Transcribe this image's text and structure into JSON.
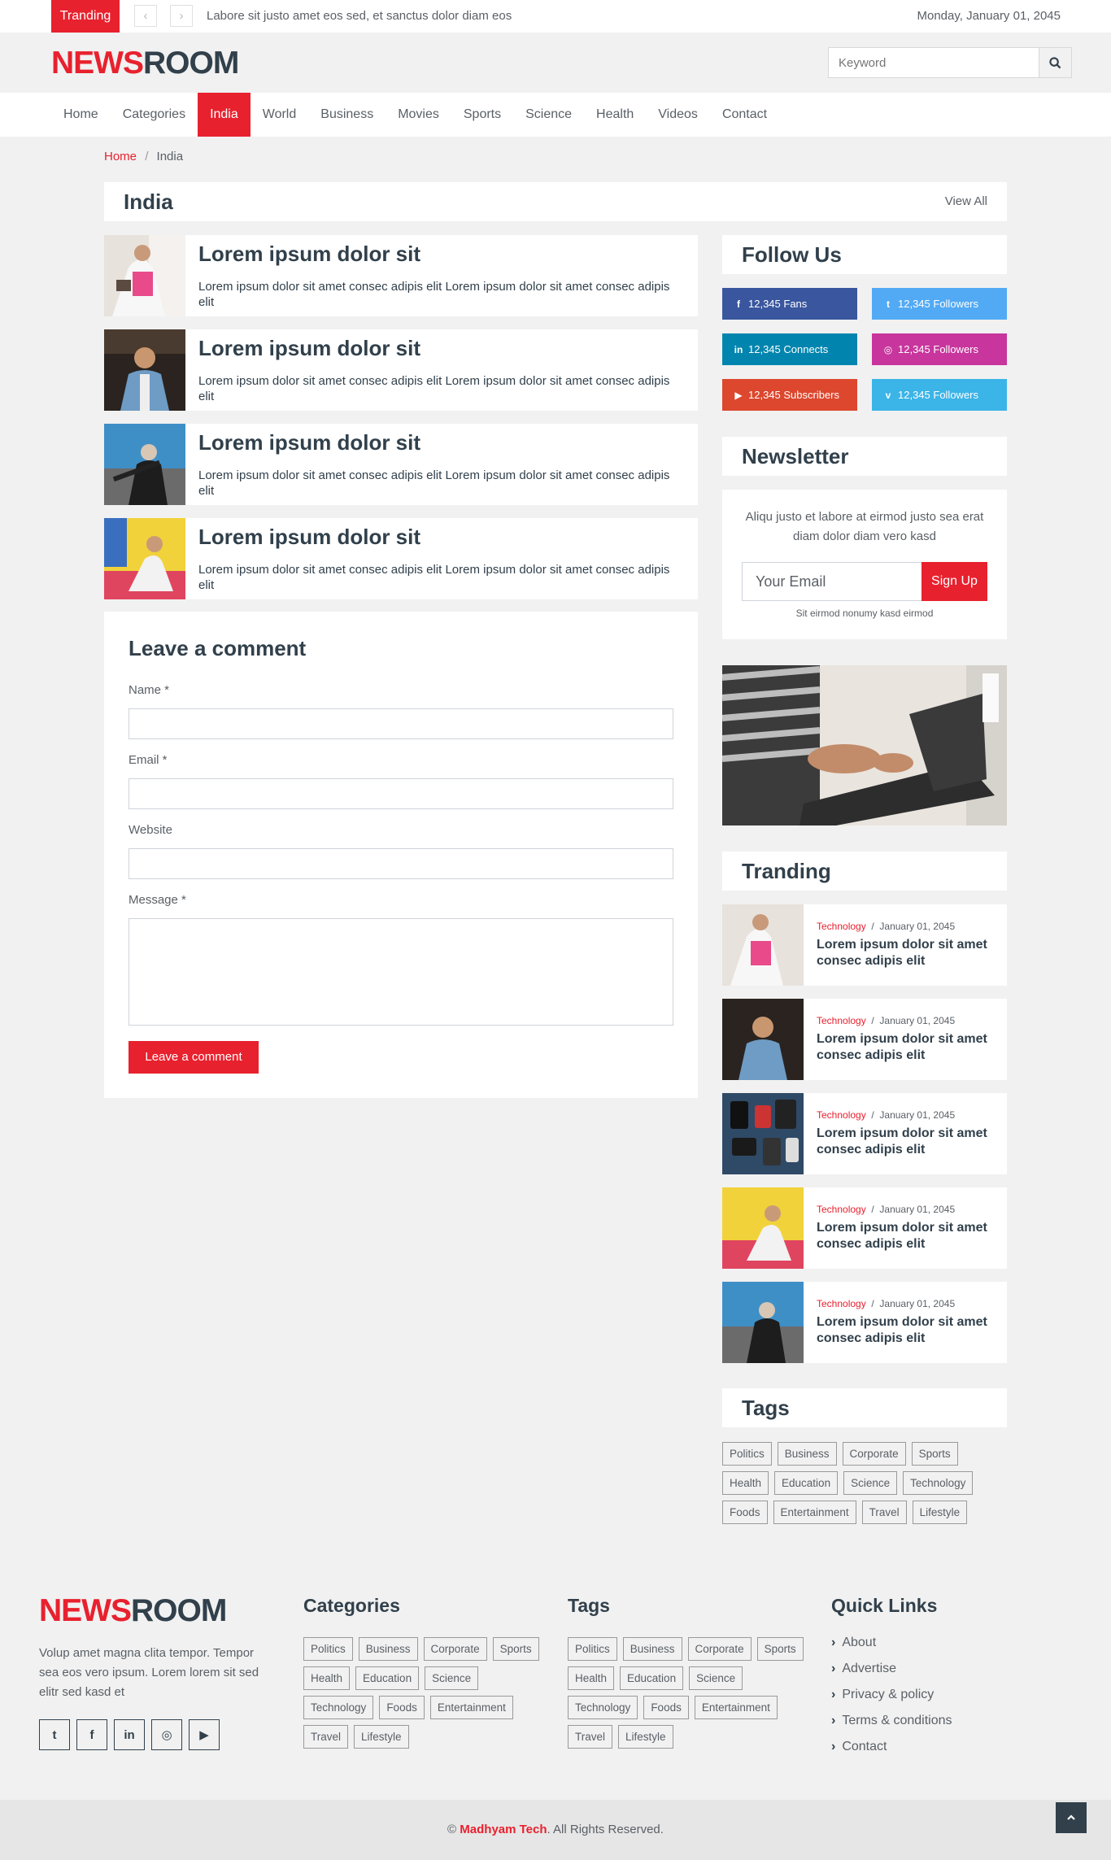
{
  "topbar": {
    "label": "Tranding",
    "prev": "‹",
    "next": "›",
    "ticker": "Labore sit justo amet eos sed, et sanctus dolor diam eos",
    "date": "Monday, January 01, 2045"
  },
  "logo": {
    "red": "NEWS",
    "dark": "ROOM"
  },
  "search": {
    "placeholder": "Keyword",
    "icon": "search-icon"
  },
  "nav": {
    "items": [
      "Home",
      "Categories",
      "India",
      "World",
      "Business",
      "Movies",
      "Sports",
      "Science",
      "Health",
      "Videos",
      "Contact"
    ],
    "active": "India"
  },
  "breadcrumb": {
    "home": "Home",
    "sep": "/",
    "current": "India"
  },
  "section": {
    "title": "India",
    "view_all": "View All"
  },
  "news": [
    {
      "title": "Lorem ipsum dolor sit",
      "desc": "Lorem ipsum dolor sit amet consec adipis elit Lorem ipsum dolor sit amet consec adipis elit"
    },
    {
      "title": "Lorem ipsum dolor sit",
      "desc": "Lorem ipsum dolor sit amet consec adipis elit Lorem ipsum dolor sit amet consec adipis elit"
    },
    {
      "title": "Lorem ipsum dolor sit",
      "desc": "Lorem ipsum dolor sit amet consec adipis elit Lorem ipsum dolor sit amet consec adipis elit"
    },
    {
      "title": "Lorem ipsum dolor sit",
      "desc": "Lorem ipsum dolor sit amet consec adipis elit Lorem ipsum dolor sit amet consec adipis elit"
    }
  ],
  "comment": {
    "heading": "Leave a comment",
    "name_label": "Name *",
    "email_label": "Email *",
    "website_label": "Website",
    "message_label": "Message *",
    "submit": "Leave a comment"
  },
  "follow": {
    "heading": "Follow Us",
    "items": [
      {
        "icon": "facebook-icon",
        "glyph": "f",
        "text": "12,345 Fans",
        "color": "#39569e"
      },
      {
        "icon": "twitter-icon",
        "glyph": "t",
        "text": "12,345 Followers",
        "color": "#52aaf4"
      },
      {
        "icon": "linkedin-icon",
        "glyph": "in",
        "text": "12,345 Connects",
        "color": "#0185ae"
      },
      {
        "icon": "instagram-icon",
        "glyph": "◎",
        "text": "12,345 Followers",
        "color": "#c8359d"
      },
      {
        "icon": "youtube-icon",
        "glyph": "▶",
        "text": "12,345 Subscribers",
        "color": "#dc472e"
      },
      {
        "icon": "vimeo-icon",
        "glyph": "v",
        "text": "12,345 Followers",
        "color": "#3bb4e8"
      }
    ]
  },
  "newsletter": {
    "heading": "Newsletter",
    "text": "Aliqu justo et labore at eirmod justo sea erat diam dolor diam vero kasd",
    "placeholder": "Your Email",
    "button": "Sign Up",
    "small": "Sit eirmod nonumy kasd eirmod"
  },
  "trending": {
    "heading": "Tranding",
    "items": [
      {
        "cat": "Technology",
        "date": "January 01, 2045",
        "title": "Lorem ipsum dolor sit amet consec adipis elit"
      },
      {
        "cat": "Technology",
        "date": "January 01, 2045",
        "title": "Lorem ipsum dolor sit amet consec adipis elit"
      },
      {
        "cat": "Technology",
        "date": "January 01, 2045",
        "title": "Lorem ipsum dolor sit amet consec adipis elit"
      },
      {
        "cat": "Technology",
        "date": "January 01, 2045",
        "title": "Lorem ipsum dolor sit amet consec adipis elit"
      },
      {
        "cat": "Technology",
        "date": "January 01, 2045",
        "title": "Lorem ipsum dolor sit amet consec adipis elit"
      }
    ]
  },
  "tags": {
    "heading": "Tags",
    "items": [
      "Politics",
      "Business",
      "Corporate",
      "Sports",
      "Health",
      "Education",
      "Science",
      "Technology",
      "Foods",
      "Entertainment",
      "Travel",
      "Lifestyle"
    ]
  },
  "footer": {
    "about": "Volup amet magna clita tempor. Tempor sea eos vero ipsum. Lorem lorem sit sed elitr sed kasd et",
    "social": [
      "twitter-icon",
      "facebook-icon",
      "linkedin-icon",
      "instagram-icon",
      "youtube-icon"
    ],
    "categories_heading": "Categories",
    "categories": [
      "Politics",
      "Business",
      "Corporate",
      "Sports",
      "Health",
      "Education",
      "Science",
      "Technology",
      "Foods",
      "Entertainment",
      "Travel",
      "Lifestyle"
    ],
    "tags_heading": "Tags",
    "tags": [
      "Politics",
      "Business",
      "Corporate",
      "Sports",
      "Health",
      "Education",
      "Science",
      "Technology",
      "Foods",
      "Entertainment",
      "Travel",
      "Lifestyle"
    ],
    "links_heading": "Quick Links",
    "links": [
      "About",
      "Advertise",
      "Privacy & policy",
      "Terms & conditions",
      "Contact"
    ],
    "copy_prefix": "©",
    "copy_brand": "Madhyam Tech",
    "copy_suffix": ". All Rights Reserved."
  },
  "colors": {
    "accent": "#e8212e",
    "dark": "#31404b"
  }
}
